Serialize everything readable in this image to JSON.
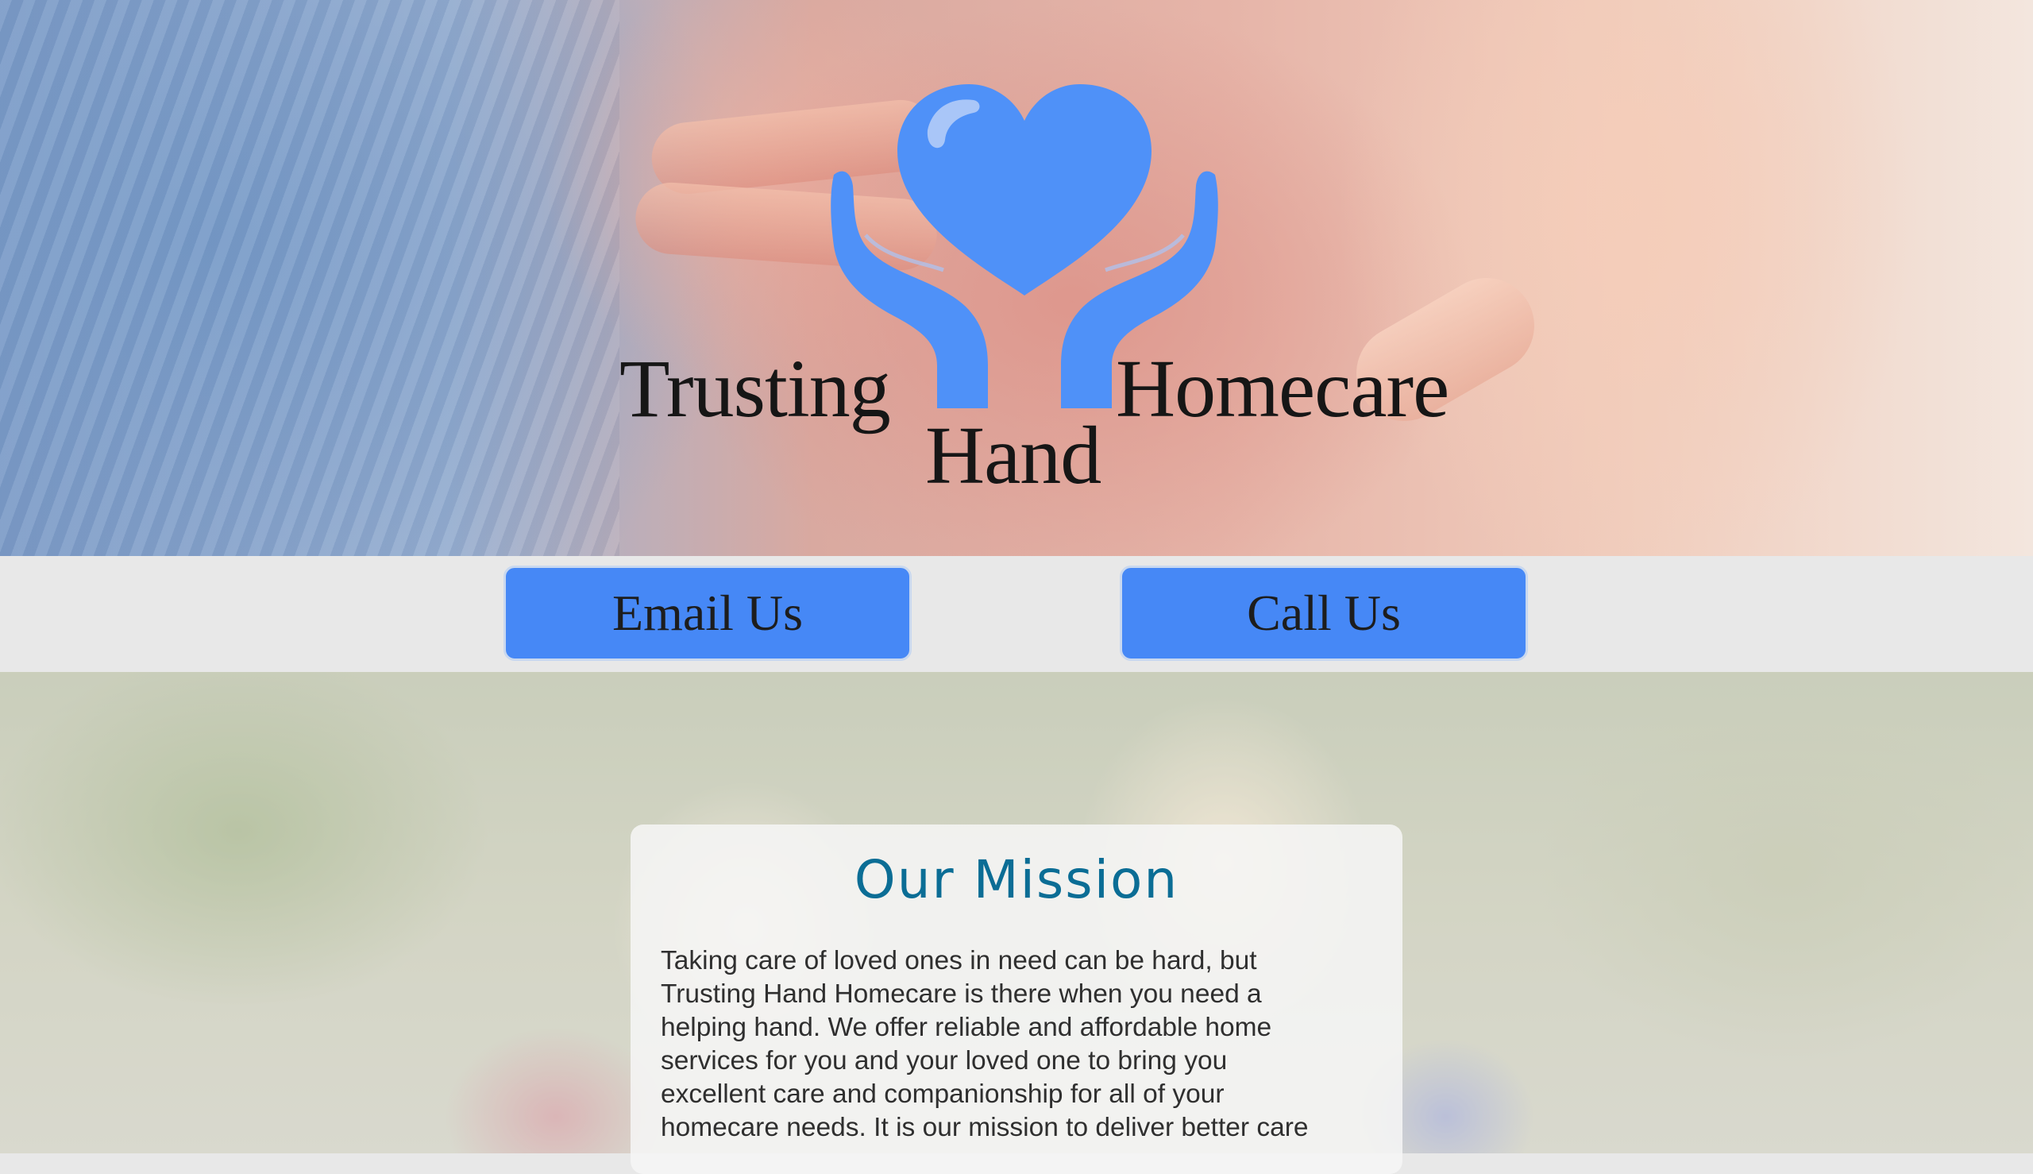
{
  "hero": {
    "logo": {
      "icon": "heart-in-hands-icon",
      "word_left": "Trusting",
      "word_right": "Homecare",
      "word_center": "Hand",
      "icon_color": "#4f91f8"
    }
  },
  "actions": {
    "email_label": "Email Us",
    "call_label": "Call Us",
    "button_color": "#4688f6"
  },
  "mission": {
    "title": "Our Mission",
    "text": "Taking care of loved ones in need can be hard, but Trusting Hand Homecare is there when you need a helping hand. We offer reliable and affordable home services for you and your loved one to bring you excellent care and companionship for all of your homecare needs. It is our mission to deliver better care",
    "title_color": "#0b6d95"
  }
}
